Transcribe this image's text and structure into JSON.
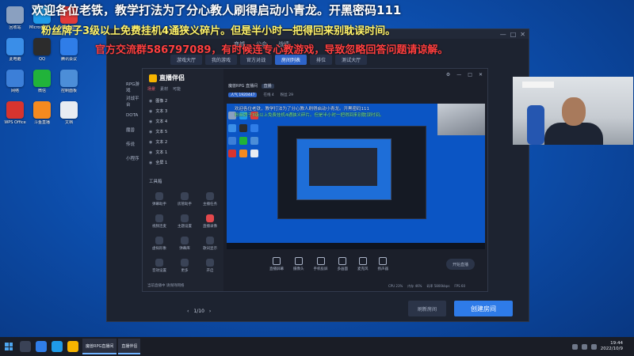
{
  "overlays": {
    "line1": "欢迎各位老铁，教学打法为了分心教人刷得启动小青龙。开黑密码111",
    "line2": "粉丝牌子3级以上免费挂机4通狭义碎片。但是半小时一把得回来别耽误时间。",
    "line3": "官方交流群586797089，有时候连专心教游戏，导致忽略回答问题请谅解。"
  },
  "desktop_icons": [
    {
      "label": "回收站",
      "icon": "recycle-bin-icon",
      "color": "#8aa0c0"
    },
    {
      "label": "Microsoft Edge",
      "icon": "edge-icon",
      "color": "#1f9be8"
    },
    {
      "label": "网易云音乐",
      "icon": "netease-music-icon",
      "color": "#e23a3a"
    },
    {
      "label": "此电脑",
      "icon": "computer-icon",
      "color": "#3a8ee8"
    },
    {
      "label": "QQ",
      "icon": "qq-icon",
      "color": "#2c2c2c"
    },
    {
      "label": "腾讯会议",
      "icon": "meeting-icon",
      "color": "#2f7de8"
    },
    {
      "label": "网络",
      "icon": "network-icon",
      "color": "#3c7fd8"
    },
    {
      "label": "微信",
      "icon": "wechat-icon",
      "color": "#21b33a"
    },
    {
      "label": "控制面板",
      "icon": "control-panel-icon",
      "color": "#4c8ed8"
    },
    {
      "label": "WPS Office",
      "icon": "wps-icon",
      "color": "#d8342e"
    },
    {
      "label": "斗鱼直播",
      "icon": "douyu-icon",
      "color": "#f58a1f"
    },
    {
      "label": "文档",
      "icon": "document-icon",
      "color": "#e8ecf2"
    }
  ],
  "host": {
    "top_menu": [
      "商城",
      "公会",
      "战绩"
    ],
    "tabs": [
      "游戏大厅",
      "我的游戏",
      "官方对战",
      "房间列表",
      "排位",
      "测试大厅"
    ],
    "active_tab": 3,
    "sidebar": [
      "RPG游戏",
      "对战平台",
      "DOTA",
      "魔兽",
      "传说",
      "小程序"
    ],
    "refresh_label": "刷新房间",
    "create_label": "创建房间",
    "pager": "1/10",
    "window_controls": [
      "—",
      "□",
      "✕"
    ]
  },
  "stream": {
    "app_name": "直播伴侣",
    "scene_tabs": [
      "场景",
      "素材",
      "可能"
    ],
    "sources": [
      "图像 2",
      "文本 3",
      "文本 4",
      "文本 5",
      "文本 2",
      "文本 1",
      "全屏 1"
    ],
    "tools_title": "工具箱",
    "tools": [
      "弹幕助手",
      "房管助手",
      "主播任务",
      "视频连麦",
      "主题设置",
      "直播录像",
      "虚拟形象",
      "弹幕库",
      "歌词显示",
      "音效设置",
      "更多",
      "开启"
    ],
    "status_text": "当前直播中 请保持网络",
    "header_title": "魔兽RPG 直播间",
    "live_badge": "直播",
    "stats": [
      "人气 1920447",
      "在线 4",
      "粉丝 29"
    ],
    "toolbar": [
      "直播屏幕",
      "摄像头",
      "手机投屏",
      "多画面",
      "麦克风",
      "扬声器"
    ],
    "start_label": "开始直播",
    "metrics": [
      "CPU 23%",
      "内存 46%",
      "码率 5800kbps",
      "FPS 60"
    ],
    "preview_text1": "欢迎各位老铁，教学打法为了分心教人刷得启动小青龙。开黑密码111",
    "preview_text2": "粉丝牌子3级以上免费挂机4通狭义碎片。但是半小时一把得回来别耽误时间。"
  },
  "taskbar": {
    "task_label": "魔兽RPG直播间",
    "task_label2": "直播伴侣",
    "time": "19:44",
    "date": "2022/10/9"
  }
}
